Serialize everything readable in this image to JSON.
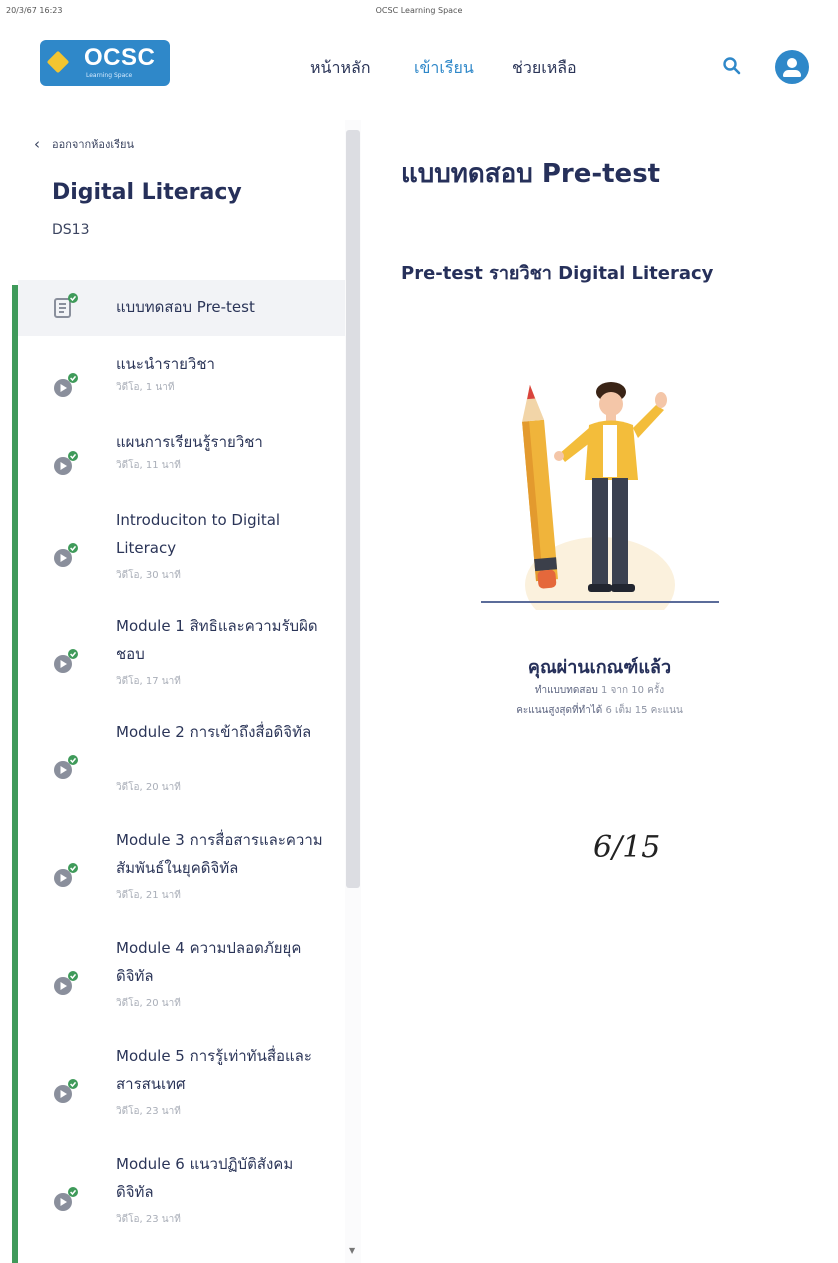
{
  "print_header": {
    "date": "20/3/67 16:23",
    "title": "OCSC Learning Space"
  },
  "logo": {
    "text": "OCSC",
    "subtext": "Learning Space"
  },
  "nav": {
    "home": "หน้าหลัก",
    "learn": "เข้าเรียน",
    "help": "ช่วยเหลือ"
  },
  "sidebar": {
    "back_label": "ออกจากห้องเรียน",
    "course_title": "Digital Literacy",
    "course_code": "DS13",
    "lessons": [
      {
        "title": "แบบทดสอบ Pre-test",
        "sub": ""
      },
      {
        "title": "แนะนำรายวิชา",
        "sub": "วิดีโอ, 1 นาที"
      },
      {
        "title": "แผนการเรียนรู้รายวิชา",
        "sub": "วิดีโอ, 11 นาที"
      },
      {
        "title": "Introduciton to Digital Literacy",
        "sub": "วิดีโอ, 30 นาที"
      },
      {
        "title": "Module 1 สิทธิและความรับผิดชอบ",
        "sub": "วิดีโอ, 17 นาที"
      },
      {
        "title": "Module 2 การเข้าถึงสื่อดิจิทัล",
        "sub": "วิดีโอ, 20 นาที"
      },
      {
        "title": "Module 3 การสื่อสารและความสัมพันธ์ในยุคดิจิทัล",
        "sub": "วิดีโอ, 21 นาที"
      },
      {
        "title": "Module 4 ความปลอดภัยยุคดิจิทัล",
        "sub": "วิดีโอ, 20 นาที"
      },
      {
        "title": "Module 5 การรู้เท่าทันสื่อและสารสนเทศ",
        "sub": "วิดีโอ, 23 นาที"
      },
      {
        "title": "Module 6 แนวปฏิบัติสังคมดิจิทัล",
        "sub": "วิดีโอ, 23 นาที"
      }
    ]
  },
  "main": {
    "page_title": "แบบทดสอบ Pre-test",
    "subtitle": "Pre-test รายวิชา Digital Literacy",
    "result_title": "คุณผ่านเกณฑ์แล้ว",
    "attempts_label": "ทำแบบทดสอบ",
    "attempts_value": "1 จาก 10 ครั้ง",
    "best_label": "คะแนนสูงสุดที่ทำได้",
    "best_value": "6 เต็ม 15 คะแนน",
    "handwritten_note": "6/15"
  },
  "colors": {
    "accent": "#2f88c9",
    "progress_green": "#3f9a5a",
    "text_dark": "#26305a"
  }
}
